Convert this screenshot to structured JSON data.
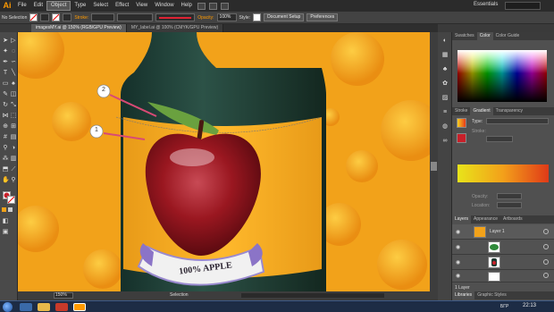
{
  "app": {
    "logo": "Ai",
    "essentials": "Essentials"
  },
  "menu": [
    "File",
    "Edit",
    "Object",
    "Type",
    "Select",
    "Effect",
    "View",
    "Window",
    "Help"
  ],
  "menu_active_index": 2,
  "control": {
    "selection": "No Selection",
    "stroke_label": "Stroke:",
    "opacity_label": "Opacity:",
    "opacity_value": "100%",
    "style_label": "Style:",
    "doc_setup": "Document Setup",
    "preferences": "Preferences"
  },
  "tabs": [
    {
      "label": "imagesMY.ai @ 150% (RGB/GPU Preview)",
      "active": true
    },
    {
      "label": "MY_label.ai @ 100% (CMYK/GPU Preview)",
      "active": false
    }
  ],
  "canvas": {
    "label_text": "100% APPLE",
    "callouts": [
      "1",
      "2"
    ],
    "colors": {
      "background": "#f2a21a",
      "bottle": "#1f3a32",
      "apple": "#9a1720",
      "leaf": "#6aa13f"
    }
  },
  "status": {
    "zoom": "150%",
    "tool": "Selection"
  },
  "panels": {
    "swatches_tabs": [
      "Swatches",
      "Color",
      "Color Guide"
    ],
    "gradient_tabs": [
      "Stroke",
      "Gradient",
      "Transparency"
    ],
    "gradient": {
      "type_label": "Type:",
      "stroke_label": "Stroke:",
      "opacity_label": "Opacity:",
      "location_label": "Location:"
    },
    "layers_tabs": [
      "Layers",
      "Appearance",
      "Artboards"
    ],
    "layer_name": "Layer 1",
    "layer_count": "1 Layer",
    "libraries_tabs": [
      "Libraries",
      "Graphic Styles"
    ]
  },
  "taskbar": {
    "time": "22:13",
    "lang": "БГР"
  }
}
